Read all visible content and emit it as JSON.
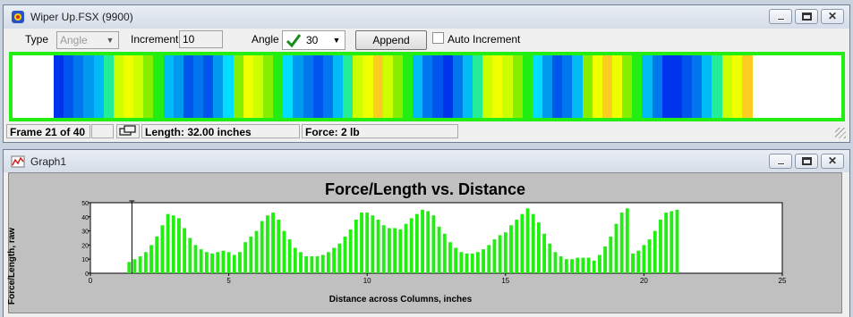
{
  "main_window": {
    "title": "Wiper Up.FSX (9900)",
    "toolbar": {
      "type_label": "Type",
      "type_value": "Angle",
      "increment_label": "Increment",
      "increment_value": "10",
      "angle_label": "Angle",
      "angle_value": "30",
      "append_label": "Append",
      "auto_increment_label": "Auto Increment",
      "auto_increment_checked": false
    },
    "strip_colors": [
      "#0033ee",
      "#0055ee",
      "#0077ee",
      "#0099f0",
      "#00bbf5",
      "#22ee99",
      "#ccff00",
      "#eeff00",
      "#ccff00",
      "#88ee00",
      "#22ee11",
      "#00bbf5",
      "#0099f0",
      "#0055ee",
      "#0077ee",
      "#0055ee",
      "#0099f0",
      "#00ddff",
      "#88ee00",
      "#eeff00",
      "#ccff00",
      "#88ee00",
      "#22ee11",
      "#00ddff",
      "#0099f0",
      "#0077ee",
      "#0055ee",
      "#0077ee",
      "#00bbf5",
      "#22ee99",
      "#ccff00",
      "#eeff00",
      "#ffcc22",
      "#ccff00",
      "#88ee00",
      "#22ee11",
      "#00bbf5",
      "#0077ee",
      "#0055ee",
      "#0033ee",
      "#0077ee",
      "#00bbf5",
      "#22ee99",
      "#ccff00",
      "#eeff00",
      "#ccff00",
      "#88ee00",
      "#22ee11",
      "#00ddff",
      "#0099f0",
      "#0055ee",
      "#0077ee",
      "#00bbf5",
      "#88ee00",
      "#eeff00",
      "#ffcc22",
      "#eeff00",
      "#88ee00",
      "#22ee11",
      "#00bbf5",
      "#0077ee",
      "#0033ee",
      "#0033ee",
      "#0055ee",
      "#0077ee",
      "#00bbf5",
      "#22ee99",
      "#ccff00",
      "#eeff00",
      "#ffcc22"
    ],
    "status": {
      "frame": "Frame 21 of 40",
      "length": "Length: 32.00 inches",
      "force": "Force: 2 lb"
    }
  },
  "graph_window": {
    "title": "Graph1"
  },
  "chart_data": {
    "type": "bar",
    "title": "Force/Length vs. Distance",
    "xlabel": "Distance across Columns, inches",
    "ylabel": "Force/Length, raw",
    "xlim": [
      0,
      25
    ],
    "ylim": [
      0,
      50
    ],
    "xticks": [
      0,
      5,
      10,
      15,
      20,
      25
    ],
    "yticks": [
      0,
      10,
      20,
      30,
      40,
      50
    ],
    "bar_color": "#22ee11",
    "marker_x": 1.5,
    "x": [
      1.4,
      1.6,
      1.8,
      2.0,
      2.2,
      2.4,
      2.6,
      2.8,
      3.0,
      3.2,
      3.4,
      3.6,
      3.8,
      4.0,
      4.2,
      4.4,
      4.6,
      4.8,
      5.0,
      5.2,
      5.4,
      5.6,
      5.8,
      6.0,
      6.2,
      6.4,
      6.6,
      6.8,
      7.0,
      7.2,
      7.4,
      7.6,
      7.8,
      8.0,
      8.2,
      8.4,
      8.6,
      8.8,
      9.0,
      9.2,
      9.4,
      9.6,
      9.8,
      10.0,
      10.2,
      10.4,
      10.6,
      10.8,
      11.0,
      11.2,
      11.4,
      11.6,
      11.8,
      12.0,
      12.2,
      12.4,
      12.6,
      12.8,
      13.0,
      13.2,
      13.4,
      13.6,
      13.8,
      14.0,
      14.2,
      14.4,
      14.6,
      14.8,
      15.0,
      15.2,
      15.4,
      15.6,
      15.8,
      16.0,
      16.2,
      16.4,
      16.6,
      16.8,
      17.0,
      17.2,
      17.4,
      17.6,
      17.8,
      18.0,
      18.2,
      18.4,
      18.6,
      18.8,
      19.0,
      19.2,
      19.4,
      19.6,
      19.8,
      20.0,
      20.2,
      20.4,
      20.6,
      20.8,
      21.0,
      21.2
    ],
    "values": [
      8,
      10,
      12,
      15,
      20,
      26,
      34,
      42,
      41,
      39,
      32,
      25,
      20,
      17,
      15,
      14,
      15,
      16,
      15,
      13,
      15,
      22,
      26,
      30,
      37,
      41,
      43,
      38,
      30,
      24,
      18,
      15,
      12,
      12,
      12,
      13,
      15,
      18,
      21,
      26,
      31,
      38,
      43,
      43,
      41,
      38,
      34,
      32,
      32,
      31,
      35,
      39,
      42,
      45,
      44,
      41,
      33,
      28,
      22,
      18,
      15,
      14,
      14,
      15,
      17,
      20,
      24,
      27,
      29,
      34,
      38,
      42,
      46,
      42,
      36,
      28,
      21,
      15,
      12,
      10,
      10,
      11,
      11,
      11,
      9,
      13,
      19,
      26,
      35,
      43,
      46,
      14,
      16,
      20,
      24,
      30,
      38,
      43,
      44,
      45
    ]
  }
}
